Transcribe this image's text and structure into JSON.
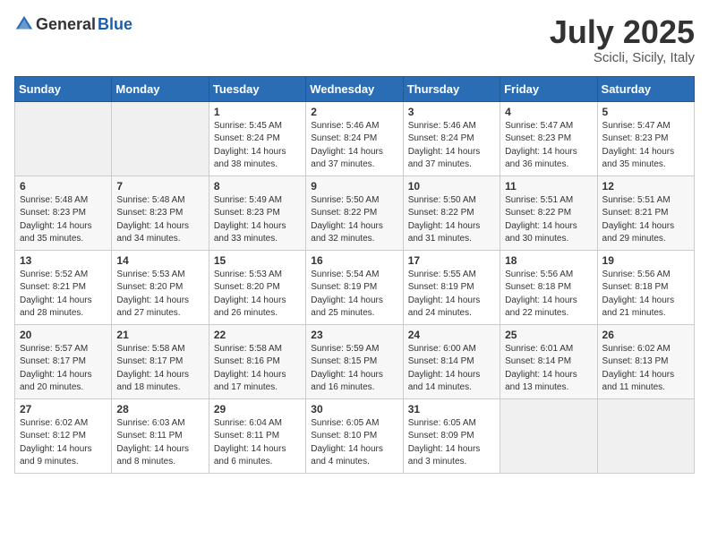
{
  "header": {
    "logo_general": "General",
    "logo_blue": "Blue",
    "month": "July 2025",
    "location": "Scicli, Sicily, Italy"
  },
  "weekdays": [
    "Sunday",
    "Monday",
    "Tuesday",
    "Wednesday",
    "Thursday",
    "Friday",
    "Saturday"
  ],
  "weeks": [
    [
      {
        "day": "",
        "sunrise": "",
        "sunset": "",
        "daylight": ""
      },
      {
        "day": "",
        "sunrise": "",
        "sunset": "",
        "daylight": ""
      },
      {
        "day": "1",
        "sunrise": "Sunrise: 5:45 AM",
        "sunset": "Sunset: 8:24 PM",
        "daylight": "Daylight: 14 hours and 38 minutes."
      },
      {
        "day": "2",
        "sunrise": "Sunrise: 5:46 AM",
        "sunset": "Sunset: 8:24 PM",
        "daylight": "Daylight: 14 hours and 37 minutes."
      },
      {
        "day": "3",
        "sunrise": "Sunrise: 5:46 AM",
        "sunset": "Sunset: 8:24 PM",
        "daylight": "Daylight: 14 hours and 37 minutes."
      },
      {
        "day": "4",
        "sunrise": "Sunrise: 5:47 AM",
        "sunset": "Sunset: 8:23 PM",
        "daylight": "Daylight: 14 hours and 36 minutes."
      },
      {
        "day": "5",
        "sunrise": "Sunrise: 5:47 AM",
        "sunset": "Sunset: 8:23 PM",
        "daylight": "Daylight: 14 hours and 35 minutes."
      }
    ],
    [
      {
        "day": "6",
        "sunrise": "Sunrise: 5:48 AM",
        "sunset": "Sunset: 8:23 PM",
        "daylight": "Daylight: 14 hours and 35 minutes."
      },
      {
        "day": "7",
        "sunrise": "Sunrise: 5:48 AM",
        "sunset": "Sunset: 8:23 PM",
        "daylight": "Daylight: 14 hours and 34 minutes."
      },
      {
        "day": "8",
        "sunrise": "Sunrise: 5:49 AM",
        "sunset": "Sunset: 8:23 PM",
        "daylight": "Daylight: 14 hours and 33 minutes."
      },
      {
        "day": "9",
        "sunrise": "Sunrise: 5:50 AM",
        "sunset": "Sunset: 8:22 PM",
        "daylight": "Daylight: 14 hours and 32 minutes."
      },
      {
        "day": "10",
        "sunrise": "Sunrise: 5:50 AM",
        "sunset": "Sunset: 8:22 PM",
        "daylight": "Daylight: 14 hours and 31 minutes."
      },
      {
        "day": "11",
        "sunrise": "Sunrise: 5:51 AM",
        "sunset": "Sunset: 8:22 PM",
        "daylight": "Daylight: 14 hours and 30 minutes."
      },
      {
        "day": "12",
        "sunrise": "Sunrise: 5:51 AM",
        "sunset": "Sunset: 8:21 PM",
        "daylight": "Daylight: 14 hours and 29 minutes."
      }
    ],
    [
      {
        "day": "13",
        "sunrise": "Sunrise: 5:52 AM",
        "sunset": "Sunset: 8:21 PM",
        "daylight": "Daylight: 14 hours and 28 minutes."
      },
      {
        "day": "14",
        "sunrise": "Sunrise: 5:53 AM",
        "sunset": "Sunset: 8:20 PM",
        "daylight": "Daylight: 14 hours and 27 minutes."
      },
      {
        "day": "15",
        "sunrise": "Sunrise: 5:53 AM",
        "sunset": "Sunset: 8:20 PM",
        "daylight": "Daylight: 14 hours and 26 minutes."
      },
      {
        "day": "16",
        "sunrise": "Sunrise: 5:54 AM",
        "sunset": "Sunset: 8:19 PM",
        "daylight": "Daylight: 14 hours and 25 minutes."
      },
      {
        "day": "17",
        "sunrise": "Sunrise: 5:55 AM",
        "sunset": "Sunset: 8:19 PM",
        "daylight": "Daylight: 14 hours and 24 minutes."
      },
      {
        "day": "18",
        "sunrise": "Sunrise: 5:56 AM",
        "sunset": "Sunset: 8:18 PM",
        "daylight": "Daylight: 14 hours and 22 minutes."
      },
      {
        "day": "19",
        "sunrise": "Sunrise: 5:56 AM",
        "sunset": "Sunset: 8:18 PM",
        "daylight": "Daylight: 14 hours and 21 minutes."
      }
    ],
    [
      {
        "day": "20",
        "sunrise": "Sunrise: 5:57 AM",
        "sunset": "Sunset: 8:17 PM",
        "daylight": "Daylight: 14 hours and 20 minutes."
      },
      {
        "day": "21",
        "sunrise": "Sunrise: 5:58 AM",
        "sunset": "Sunset: 8:17 PM",
        "daylight": "Daylight: 14 hours and 18 minutes."
      },
      {
        "day": "22",
        "sunrise": "Sunrise: 5:58 AM",
        "sunset": "Sunset: 8:16 PM",
        "daylight": "Daylight: 14 hours and 17 minutes."
      },
      {
        "day": "23",
        "sunrise": "Sunrise: 5:59 AM",
        "sunset": "Sunset: 8:15 PM",
        "daylight": "Daylight: 14 hours and 16 minutes."
      },
      {
        "day": "24",
        "sunrise": "Sunrise: 6:00 AM",
        "sunset": "Sunset: 8:14 PM",
        "daylight": "Daylight: 14 hours and 14 minutes."
      },
      {
        "day": "25",
        "sunrise": "Sunrise: 6:01 AM",
        "sunset": "Sunset: 8:14 PM",
        "daylight": "Daylight: 14 hours and 13 minutes."
      },
      {
        "day": "26",
        "sunrise": "Sunrise: 6:02 AM",
        "sunset": "Sunset: 8:13 PM",
        "daylight": "Daylight: 14 hours and 11 minutes."
      }
    ],
    [
      {
        "day": "27",
        "sunrise": "Sunrise: 6:02 AM",
        "sunset": "Sunset: 8:12 PM",
        "daylight": "Daylight: 14 hours and 9 minutes."
      },
      {
        "day": "28",
        "sunrise": "Sunrise: 6:03 AM",
        "sunset": "Sunset: 8:11 PM",
        "daylight": "Daylight: 14 hours and 8 minutes."
      },
      {
        "day": "29",
        "sunrise": "Sunrise: 6:04 AM",
        "sunset": "Sunset: 8:11 PM",
        "daylight": "Daylight: 14 hours and 6 minutes."
      },
      {
        "day": "30",
        "sunrise": "Sunrise: 6:05 AM",
        "sunset": "Sunset: 8:10 PM",
        "daylight": "Daylight: 14 hours and 4 minutes."
      },
      {
        "day": "31",
        "sunrise": "Sunrise: 6:05 AM",
        "sunset": "Sunset: 8:09 PM",
        "daylight": "Daylight: 14 hours and 3 minutes."
      },
      {
        "day": "",
        "sunrise": "",
        "sunset": "",
        "daylight": ""
      },
      {
        "day": "",
        "sunrise": "",
        "sunset": "",
        "daylight": ""
      }
    ]
  ]
}
